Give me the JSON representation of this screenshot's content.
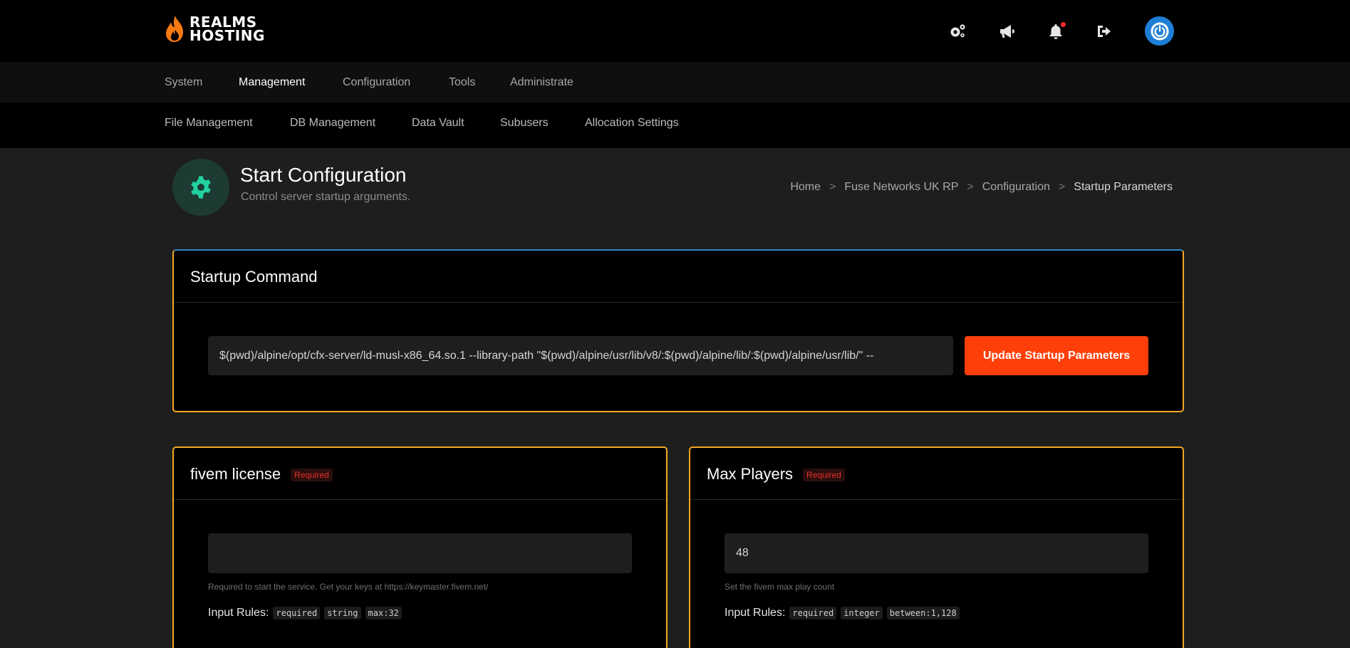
{
  "brand": {
    "logo_line1": "REALMS",
    "logo_line2": "HOSTING"
  },
  "header_icons": [
    "settings-icon",
    "megaphone-icon",
    "bell-icon",
    "sign-out-icon",
    "power-icon"
  ],
  "main_nav": {
    "items": [
      {
        "label": "System"
      },
      {
        "label": "Management",
        "active": true
      },
      {
        "label": "Configuration"
      },
      {
        "label": "Tools"
      },
      {
        "label": "Administrate"
      }
    ]
  },
  "sub_nav": {
    "items": [
      {
        "label": "File Management"
      },
      {
        "label": "DB Management"
      },
      {
        "label": "Data Vault"
      },
      {
        "label": "Subusers"
      },
      {
        "label": "Allocation Settings"
      }
    ]
  },
  "page": {
    "title": "Start Configuration",
    "subtitle": "Control server startup arguments."
  },
  "breadcrumb": {
    "items": [
      "Home",
      "Fuse Networks UK RP",
      "Configuration",
      "Startup Parameters"
    ],
    "separator": ">"
  },
  "startup": {
    "title": "Startup Command",
    "command": "$(pwd)/alpine/opt/cfx-server/ld-musl-x86_64.so.1 --library-path \"$(pwd)/alpine/usr/lib/v8/:$(pwd)/alpine/lib/:$(pwd)/alpine/usr/lib/\" --",
    "button_label": "Update Startup Parameters"
  },
  "variables": [
    {
      "title": "fivem license",
      "badge": "Required",
      "value": "",
      "help": "Required to start the service. Get your keys at https://keymaster.fivem.net/",
      "rules_label": "Input Rules:",
      "rules": [
        "required",
        "string",
        "max:32"
      ]
    },
    {
      "title": "Max Players",
      "badge": "Required",
      "value": "48",
      "help": "Set the fivem max play count",
      "rules_label": "Input Rules:",
      "rules": [
        "required",
        "integer",
        "between:1,128"
      ]
    }
  ],
  "colors": {
    "accent_orange": "#ff3f0a",
    "card_border": "#f6a623",
    "card_top_border": "#2f86c9",
    "page_icon_green": "#21d19f",
    "power_blue": "#1e7fd6",
    "required_red": "#e8322a"
  }
}
